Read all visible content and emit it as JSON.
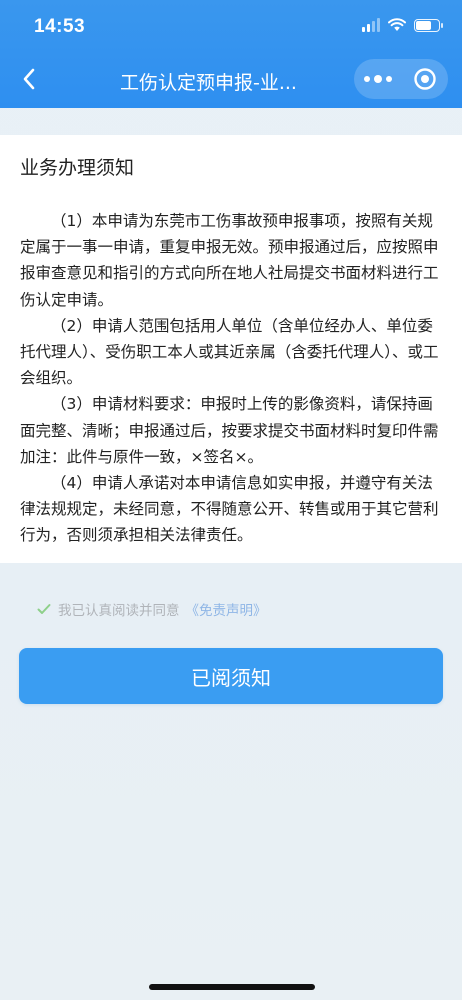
{
  "status_bar": {
    "time": "14:53"
  },
  "navbar": {
    "title": "工伤认定预申报-业...",
    "back_icon": "chevron-left-icon",
    "more_icon": "more-dots-icon",
    "close_icon": "target-circle-icon"
  },
  "notice": {
    "title": "业务办理须知",
    "paragraphs": [
      "（1）本申请为东莞市工伤事故预申报事项，按照有关规定属于一事一申请，重复申报无效。预申报通过后，应按照申报审查意见和指引的方式向所在地人社局提交书面材料进行工伤认定申请。",
      "（2）申请人范围包括用人单位（含单位经办人、单位委托代理人）、受伤职工本人或其近亲属（含委托代理人）、或工会组织。",
      "（3）申请材料要求：申报时上传的影像资料，请保持画面完整、清晰；申报通过后，按要求提交书面材料时复印件需加注：此件与原件一致，×签名×。",
      "（4）申请人承诺对本申请信息如实申报，并遵守有关法律法规规定，未经同意，不得随意公开、转售或用于其它营利行为，否则须承担相关法律责任。"
    ]
  },
  "agreement": {
    "text": "我已认真阅读并同意",
    "link": "《免责声明》",
    "checked": true
  },
  "primary_button": {
    "label": "已阅须知"
  },
  "colors": {
    "header": "#3a97ee",
    "button": "#3a9df2",
    "check": "#8ed08a",
    "link": "#8fb6e6"
  }
}
